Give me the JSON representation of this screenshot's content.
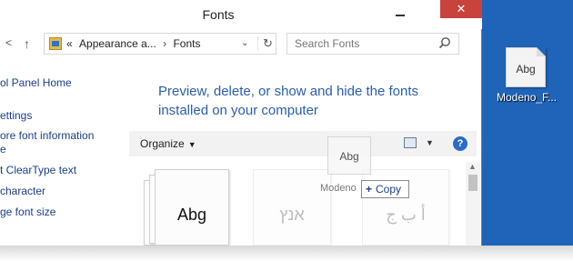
{
  "window": {
    "title": "Fonts",
    "minimize_glyph": "",
    "close_glyph": "✕"
  },
  "address_bar": {
    "back_glyph": "<",
    "up_glyph": "↑",
    "crumbs": [
      "Appearance a...",
      "Fonts"
    ],
    "crumb_prefix": "«",
    "separator": "›",
    "dropdown_glyph": "⌄",
    "refresh_glyph": "↻"
  },
  "search": {
    "placeholder": "Search Fonts"
  },
  "nav_pane": {
    "items": [
      "ol Panel Home",
      "ettings",
      "ore font information",
      "e",
      "t ClearType text",
      " character",
      "ge font size"
    ]
  },
  "content": {
    "heading_line1": "Preview, delete, or show and hide the fonts",
    "heading_line2": "installed on your computer"
  },
  "command_bar": {
    "organize_label": "Organize",
    "organize_caret": "▼",
    "view_caret": "▼",
    "help_glyph": "?"
  },
  "font_tiles": [
    {
      "glyph": "Abg"
    },
    {
      "glyph": "אנץ"
    },
    {
      "glyph": "أ ب ج"
    }
  ],
  "drag": {
    "ghost_glyph": "Abg",
    "ghost_name": "Modeno",
    "copy_label": "Copy",
    "copy_icon": "+"
  },
  "desktop_icon": {
    "glyph": "Abg",
    "name": "Modeno_F..."
  },
  "colors": {
    "desktop_bg": "#1f64b8",
    "close_button": "#c7433b",
    "heading_text": "#2b5ea8",
    "link_text": "#1a3e8a"
  }
}
